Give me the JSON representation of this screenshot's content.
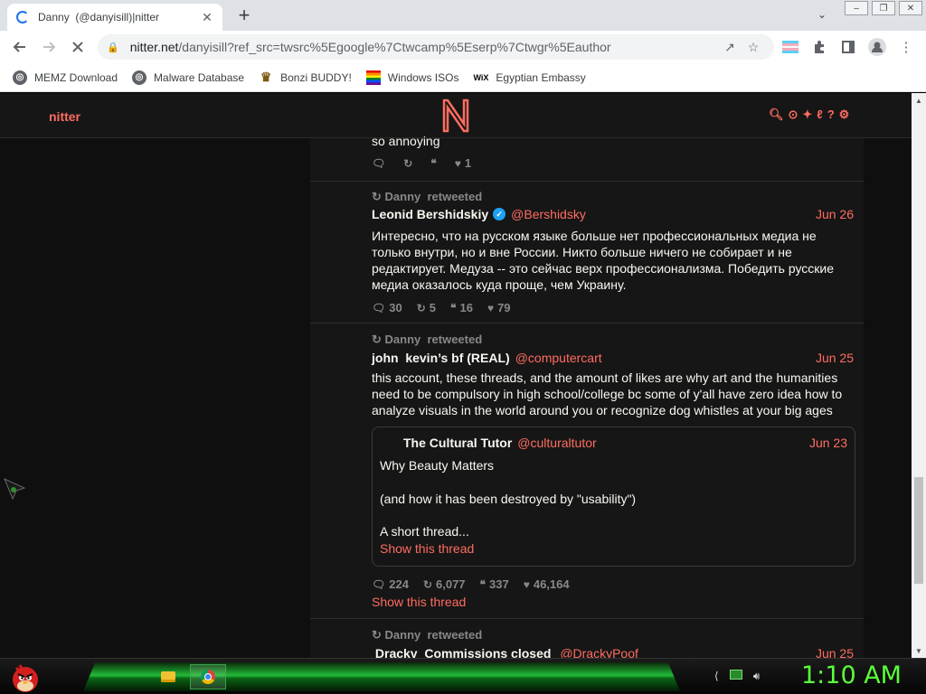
{
  "browser": {
    "tab_title": "Danny ⁣⁣⁣⁣ (@danyisill)|nitter",
    "tab_close": "✕",
    "new_tab": "+",
    "tab_menu": "⌄",
    "window_controls": [
      "–",
      "❐",
      "✕"
    ],
    "url_host": "nitter.net",
    "url_path": "/danyisill?ref_src=twsrc%5Egoogle%7Ctwcamp%5Eserp%7Ctwgr%5Eauthor",
    "bookmarks": [
      {
        "label": "MEMZ Download",
        "icon": "globe-icon"
      },
      {
        "label": "Malware Database",
        "icon": "globe-icon"
      },
      {
        "label": "Bonzi BUDDY!",
        "icon": "bonzi-icon"
      },
      {
        "label": "Windows ISOs",
        "icon": "rainbow-flag-icon"
      },
      {
        "label": "Egyptian Embassy",
        "icon": "wix-icon",
        "icon_text": "WiX"
      }
    ]
  },
  "nitter": {
    "brand": "nitter",
    "accent": "#ff6c60"
  },
  "timeline": {
    "prev_tweet": {
      "text": "so annoying",
      "likes": "1"
    },
    "tweet1": {
      "retweet_header": "Danny ⁣⁣⁣⁣ retweeted",
      "name": "Leonid Bershidskiy",
      "handle": "@Bershidsky",
      "date": "Jun 26",
      "lines": [
        "Интересно, что на русском языке больше нет профессиональных медиа не",
        "только внутри, но и вне России. Никто больше ничего не собирает и не",
        "редактирует. Медуза -- это сейчас верх профессионализма. Победить русские",
        "медиа оказалось куда проще, чем Украину."
      ],
      "replies": "30",
      "retweets": "5",
      "quotes": "16",
      "likes": "79"
    },
    "tweet2": {
      "retweet_header": "Danny ⁣⁣⁣⁣ retweeted",
      "name": "john ⁣ kevin’s bf (REAL)",
      "handle": "@computercart",
      "date": "Jun 25",
      "lines": [
        "this account, these threads, and the amount of likes are why art and the humanities",
        "need to be compulsory in high school/college bc some of y'all have zero idea how to",
        "analyze visuals in the world around you or recognize dog whistles at your big ages"
      ],
      "quote": {
        "name": "The Cultural Tutor",
        "handle": "@culturaltutor",
        "date": "Jun 23",
        "line1": "Why Beauty Matters",
        "line2": "(and how it has been destroyed by \"usability\")",
        "line3": "A short thread...",
        "link": "Show this thread"
      },
      "replies": "224",
      "retweets": "6,077",
      "quotes": "337",
      "likes": "46,164",
      "show_thread": "Show this thread"
    },
    "tweet3": {
      "retweet_header": "Danny ⁣⁣⁣⁣ retweeted",
      "name": "⁣ Dracky ⁣ Commissions closed ⁣",
      "handle": "@DrackyPoof",
      "date": "Jun 25"
    }
  },
  "taskbar": {
    "clock": "1:10 AM"
  }
}
